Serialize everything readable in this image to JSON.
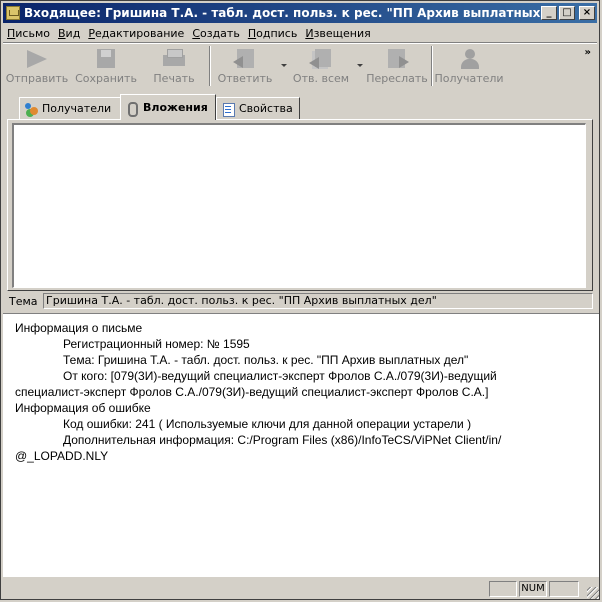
{
  "window": {
    "title": "Входящее: Гришина Т.А. - табл. дост. польз. к рес. \"ПП Архив выплатных дел\"",
    "controls": {
      "minimize": "_",
      "maximize": "□",
      "close": "×"
    }
  },
  "menu": [
    {
      "u": "П",
      "rest": "исьмо"
    },
    {
      "u": "В",
      "rest": "ид"
    },
    {
      "u": "Р",
      "rest": "едактирование"
    },
    {
      "u": "С",
      "rest": "оздать"
    },
    {
      "u": "П",
      "rest": "одпись"
    },
    {
      "u": "И",
      "rest": "звещения"
    }
  ],
  "toolbar": {
    "send": "Отправить",
    "save": "Сохранить",
    "print": "Печать",
    "reply": "Ответить",
    "reply_all": "Отв. всем",
    "forward": "Переслать",
    "recipients": "Получатели",
    "more": "»"
  },
  "tabs": {
    "recipients": "Получатели",
    "attachments": "Вложения",
    "properties": "Свойства"
  },
  "subject": {
    "label": "Тема",
    "value": "Гришина Т.А. - табл. дост. польз. к рес. \"ПП Архив выплатных дел\""
  },
  "info": {
    "letter_heading": "Информация о письме",
    "reg_number": "Регистрационный номер: № 1595",
    "topic": "Тема: Гришина Т.А. - табл. дост. польз. к рес. \"ПП Архив выплатных дел\"",
    "from_line1": "От кого: [079(3И)-ведущий специалист-эксперт Фролов С.А./079(3И)-ведущий",
    "from_line2": "специалист-эксперт Фролов С.А./079(3И)-ведущий специалист-эксперт Фролов С.А.]",
    "error_heading": "Информация об ошибке",
    "error_code": "Код ошибки: 241 ( Используемые ключи для данной операции устарели )",
    "extra_line1": "Дополнительная информация: C:/Program Files (x86)/InfoTeCS/ViPNet Client/in/",
    "extra_line2": "@_LOPADD.NLY"
  },
  "statusbar": {
    "num": "NUM"
  }
}
